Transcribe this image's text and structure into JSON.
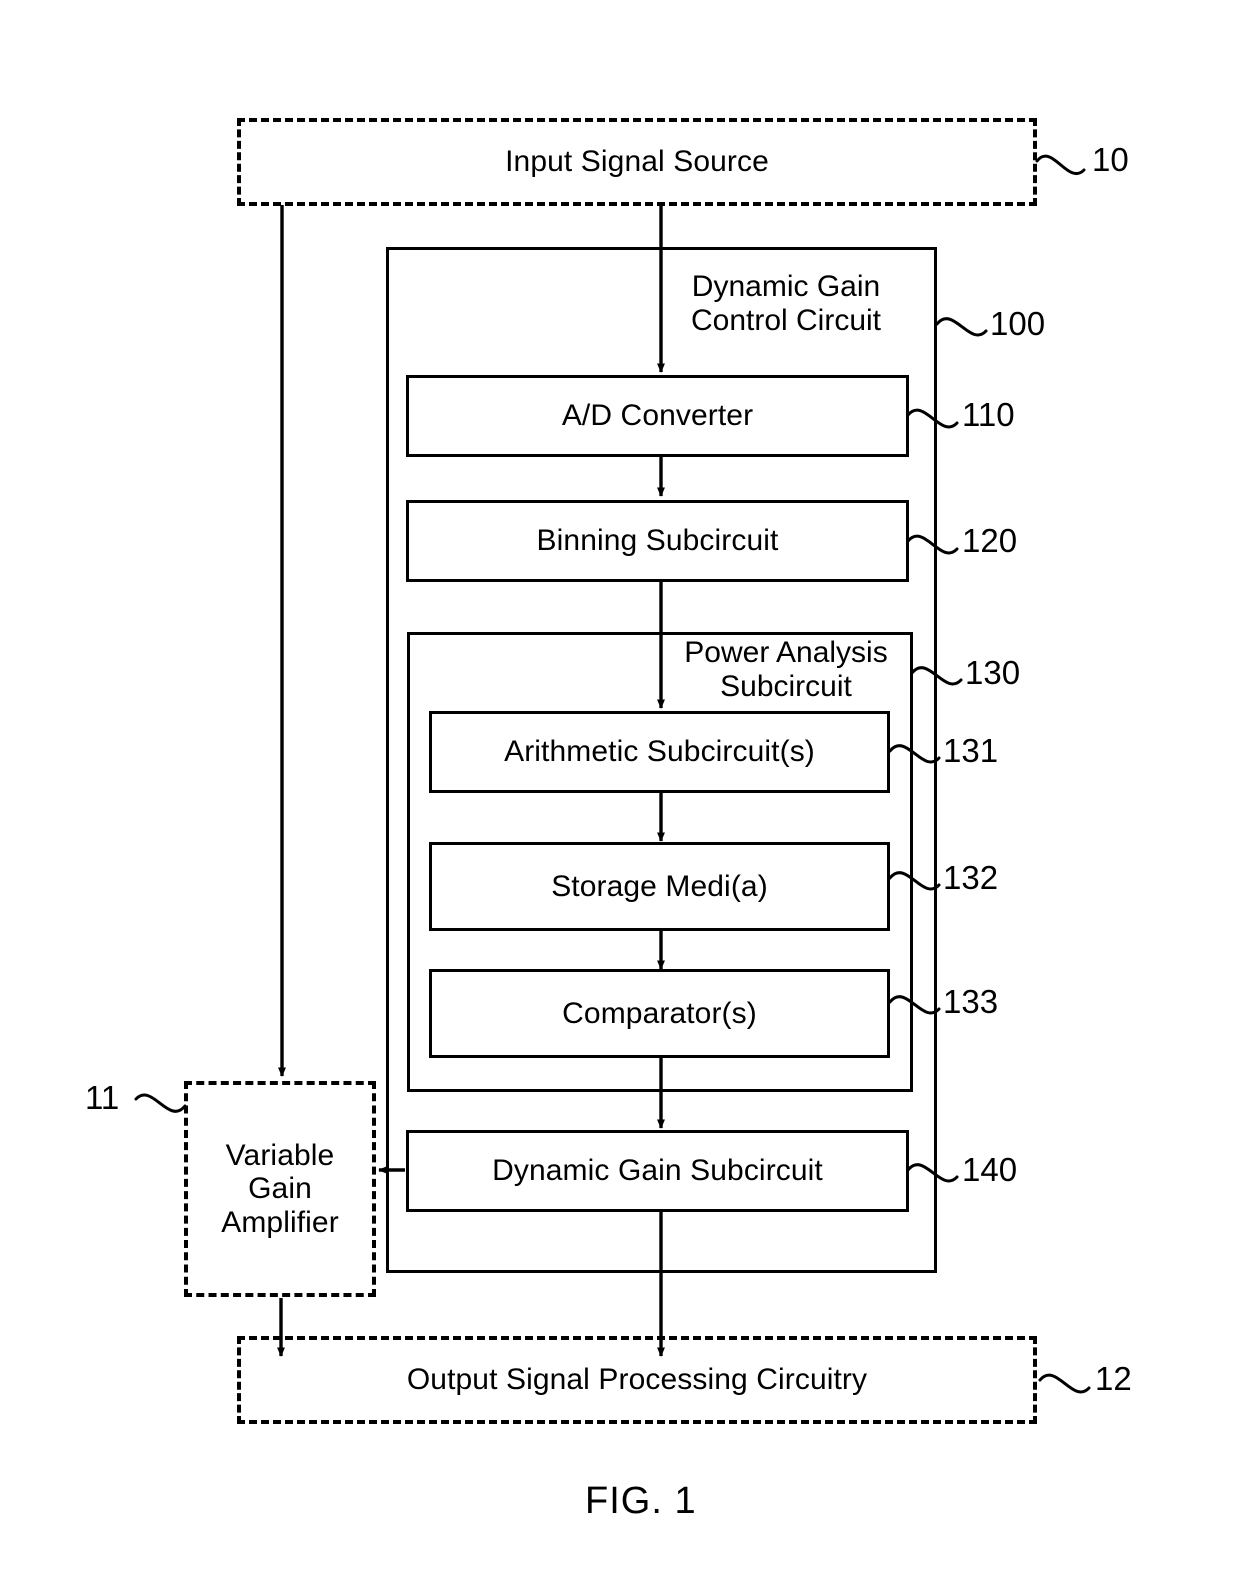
{
  "figure": {
    "caption": "FIG. 1",
    "blocks": {
      "input_signal_source": {
        "label": "Input Signal Source",
        "ref": "10",
        "style": "dashed"
      },
      "dynamic_gain_control_circuit": {
        "label": "Dynamic Gain\nControl Circuit",
        "ref": "100",
        "style": "solid"
      },
      "ad_converter": {
        "label": "A/D Converter",
        "ref": "110",
        "style": "solid"
      },
      "binning_subcircuit": {
        "label": "Binning Subcircuit",
        "ref": "120",
        "style": "solid"
      },
      "power_analysis_subcircuit": {
        "label": "Power Analysis\nSubcircuit",
        "ref": "130",
        "style": "solid"
      },
      "arithmetic_subcircuits": {
        "label": "Arithmetic Subcircuit(s)",
        "ref": "131",
        "style": "solid"
      },
      "storage_media": {
        "label": "Storage Medi(a)",
        "ref": "132",
        "style": "solid"
      },
      "comparators": {
        "label": "Comparator(s)",
        "ref": "133",
        "style": "solid"
      },
      "dynamic_gain_subcircuit": {
        "label": "Dynamic Gain Subcircuit",
        "ref": "140",
        "style": "solid"
      },
      "variable_gain_amplifier": {
        "label": "Variable\nGain\nAmplifier",
        "ref": "11",
        "style": "dashed"
      },
      "output_signal_processing_circuitry": {
        "label": "Output Signal Processing Circuitry",
        "ref": "12",
        "style": "dashed"
      }
    },
    "colors": {
      "stroke": "#000000",
      "background": "#ffffff"
    }
  }
}
